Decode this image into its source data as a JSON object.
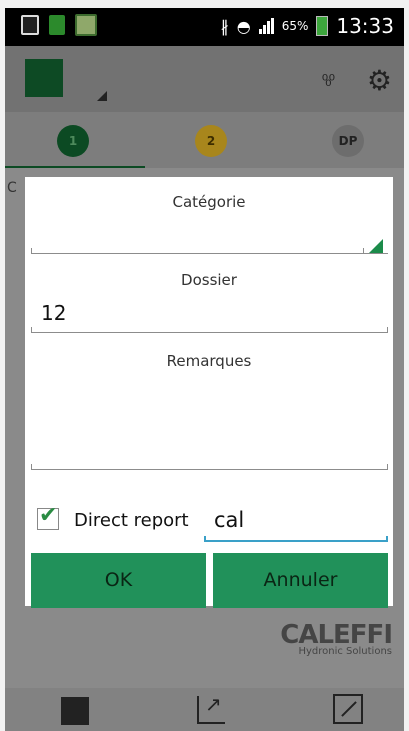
{
  "statusbar": {
    "battery_pct": "65%",
    "time": "13:33",
    "bluetooth_icon": "bluetooth-icon",
    "wifi_icon": "wifi-icon"
  },
  "appbar": {
    "logo_icon": "app-logo-icon",
    "drops_icon": "drops-icon",
    "settings_icon": "gear-icon"
  },
  "steps": [
    "1",
    "2",
    "DP"
  ],
  "background": {
    "partial_label": "C"
  },
  "dialog": {
    "category_label": "Catégorie",
    "category_value": "",
    "folder_label": "Dossier",
    "folder_value": "12",
    "remarks_label": "Remarques",
    "remarks_value": "",
    "direct_report_label": "Direct report",
    "direct_report_checked": true,
    "input_value": "cal",
    "ok_label": "OK",
    "cancel_label": "Annuler"
  },
  "brand": {
    "name": "CALEFFI",
    "tagline": "Hydronic Solutions"
  },
  "colors": {
    "accent_green": "#21915a",
    "focus_blue": "#3aa0c8"
  }
}
